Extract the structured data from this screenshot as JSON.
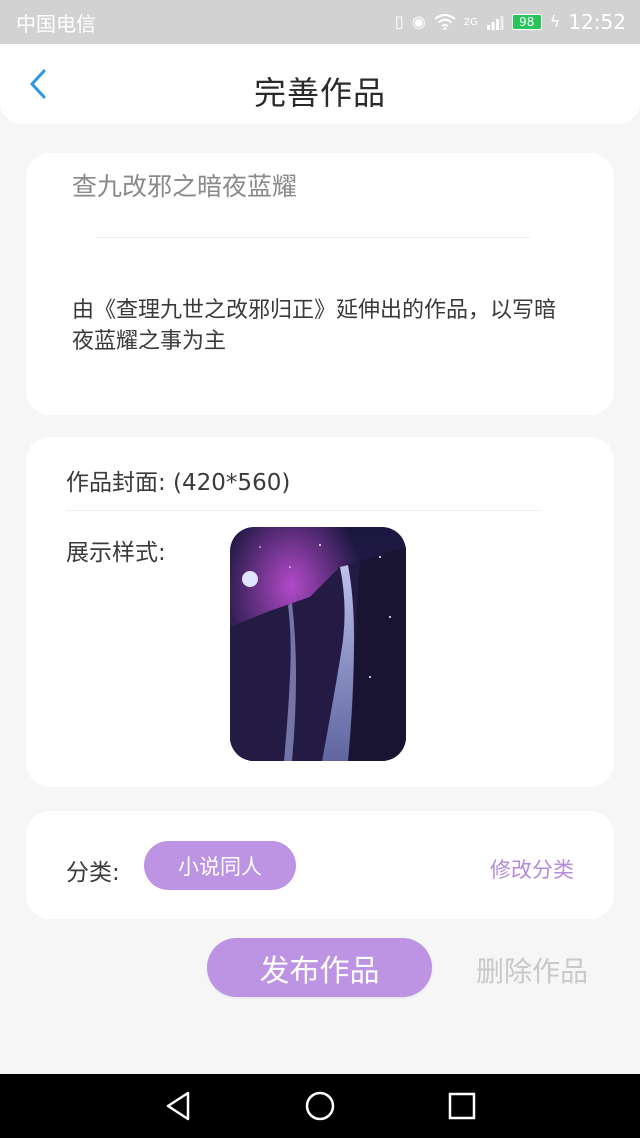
{
  "status_bar": {
    "carrier": "中国电信",
    "battery": "98",
    "network": "2G",
    "time": "12:52"
  },
  "header": {
    "title": "完善作品",
    "back_icon": "chevron-left-icon"
  },
  "work": {
    "title": "查九改邪之暗夜蓝耀",
    "description": "由《查理九世之改邪归正》延伸出的作品，以写暗夜蓝耀之事为主"
  },
  "cover": {
    "label": "作品封面:  (420*560)",
    "style_label": "展示样式:"
  },
  "category": {
    "label": "分类:",
    "value": "小说同人",
    "edit_label": "修改分类"
  },
  "actions": {
    "publish_label": "发布作品",
    "delete_label": "删除作品"
  },
  "colors": {
    "accent": "#bd93e3",
    "link": "#b48bdc",
    "back_arrow": "#2a96e6"
  }
}
